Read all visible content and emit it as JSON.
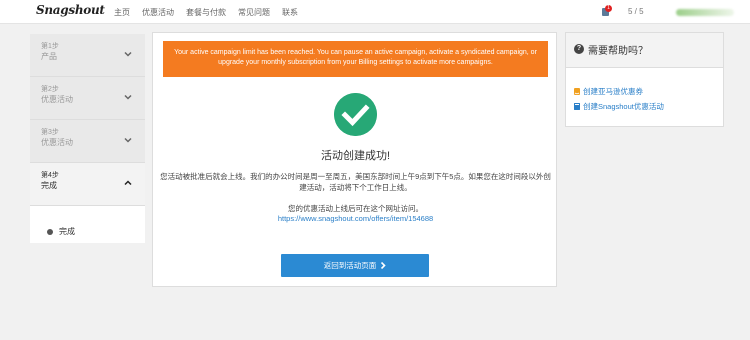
{
  "header": {
    "logo": "Snagshout",
    "nav": [
      "主页",
      "优惠活动",
      "套餐与付款",
      "常见问题",
      "联系"
    ],
    "notification_count": "1",
    "pager": "5 / 5"
  },
  "steps": [
    {
      "num": "第1步",
      "title": "产品"
    },
    {
      "num": "第2步",
      "title": "优惠活动"
    },
    {
      "num": "第3步",
      "title": "优惠活动"
    },
    {
      "num": "第4步",
      "title": "完成"
    }
  ],
  "substep": "完成",
  "main": {
    "alert": "Your active campaign limit has been reached. You can pause an active campaign, activate a syndicated campaign, or upgrade your monthly subscription from your Billing settings to activate more campaigns.",
    "success_title": "活动创建成功!",
    "description": "您活动被批准后就会上线。我们的办公时间是周一至周五，美国东部时间上午9点到下午5点。如果您在这时间段以外创建活动，活动将下个工作日上线。",
    "url_intro": "您的优惠活动上线后可在这个网址访问。",
    "url": "https://www.snagshout.com/offers/item/154688",
    "button": "返回到活动页面"
  },
  "help": {
    "title": "需要帮助吗？",
    "links": [
      "创建亚马逊优惠券",
      "创建Snagshout优惠活动"
    ]
  },
  "colors": {
    "alert": "#f47b20",
    "success": "#27a876",
    "button": "#2b8ad3",
    "link": "#2a7fc8"
  }
}
